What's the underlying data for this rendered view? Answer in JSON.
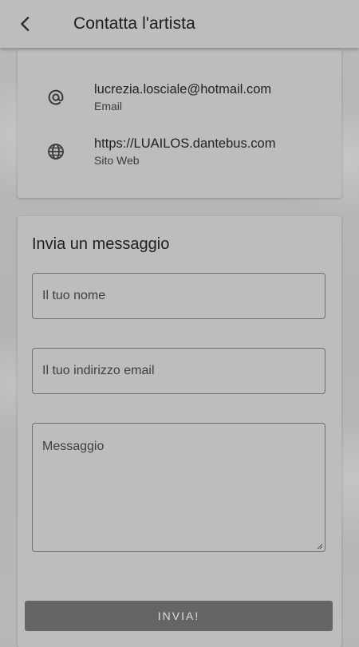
{
  "header": {
    "title": "Contatta l'artista",
    "back_icon": "chevron-left-icon"
  },
  "contact": {
    "email": {
      "value": "lucrezia.losciale@hotmail.com",
      "label": "Email",
      "icon": "at-sign-icon"
    },
    "website": {
      "value": "https://LUAILOS.dantebus.com",
      "label": "Sito Web",
      "icon": "globe-icon"
    }
  },
  "form": {
    "title": "Invia un messaggio",
    "name_placeholder": "Il tuo nome",
    "email_placeholder": "Il tuo indirizzo email",
    "message_placeholder": "Messaggio",
    "submit_label": "INVIA!"
  },
  "colors": {
    "topbar": "#bdbdbd",
    "card": "#bdbdbd",
    "button": "#656565",
    "button_text": "#dedede"
  }
}
